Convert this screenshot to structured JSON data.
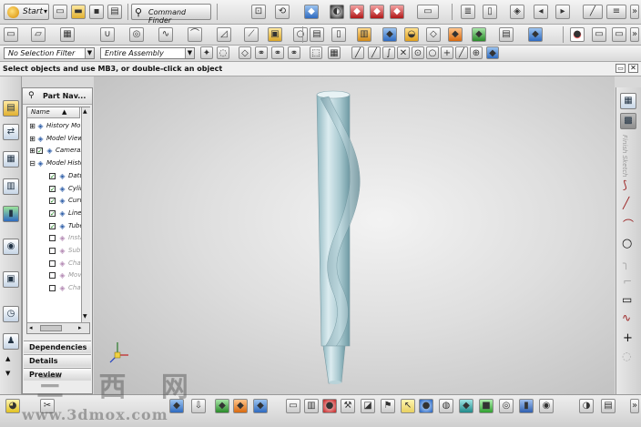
{
  "toolbar_top": {
    "start_label": "Start",
    "start_arrow": "▾",
    "command_finder_label": "Command Finder"
  },
  "filter_bar": {
    "selection_filter": "No Selection Filter",
    "scope": "Entire Assembly"
  },
  "cue_line": "Select objects and use MB3, or double-click an object",
  "navigator": {
    "title": "Part Nav...",
    "column_name": "Name",
    "sort_arrow": "▲",
    "items": [
      {
        "label": "History Mo",
        "icon": "clock-icon",
        "checked": null,
        "dim": false
      },
      {
        "label": "Model Views",
        "icon": "views-icon",
        "checked": null,
        "dim": false
      },
      {
        "label": "Cameras",
        "icon": "camera-icon",
        "checked": true,
        "dim": false
      },
      {
        "label": "Model History",
        "icon": "folder-icon",
        "checked": null,
        "dim": false
      },
      {
        "label": "Datum",
        "icon": "datum-icon",
        "checked": true,
        "dim": false
      },
      {
        "label": "Cylinder",
        "icon": "cylinder-icon",
        "checked": true,
        "dim": false
      },
      {
        "label": "Curve",
        "icon": "curve-icon",
        "checked": true,
        "dim": false
      },
      {
        "label": "Line",
        "icon": "line-icon",
        "checked": true,
        "dim": false
      },
      {
        "label": "Tube",
        "icon": "tube-icon",
        "checked": true,
        "dim": false
      },
      {
        "label": "Instance",
        "icon": "instance-icon",
        "checked": false,
        "dim": true
      },
      {
        "label": "Subtract",
        "icon": "subtract-icon",
        "checked": false,
        "dim": true
      },
      {
        "label": "Chamfer",
        "icon": "chamfer-icon",
        "checked": false,
        "dim": true
      },
      {
        "label": "Move",
        "icon": "move-icon",
        "checked": false,
        "dim": true
      },
      {
        "label": "Chamfer",
        "icon": "chamfer-icon",
        "checked": false,
        "dim": true
      }
    ],
    "sections": [
      "Dependencies",
      "Details",
      "Preview"
    ]
  },
  "right_strip": {
    "search_label": "Finish Sketch"
  },
  "watermark": {
    "chars": "三 西 网",
    "url": "www.3dmox.com"
  },
  "colors": {
    "viewport_center": "#f3f3f3",
    "viewport_edge": "#bdbdbd",
    "model_light": "#cfe4ea",
    "model_dark": "#7fa9b3",
    "check_green": "#1c8a1c"
  }
}
